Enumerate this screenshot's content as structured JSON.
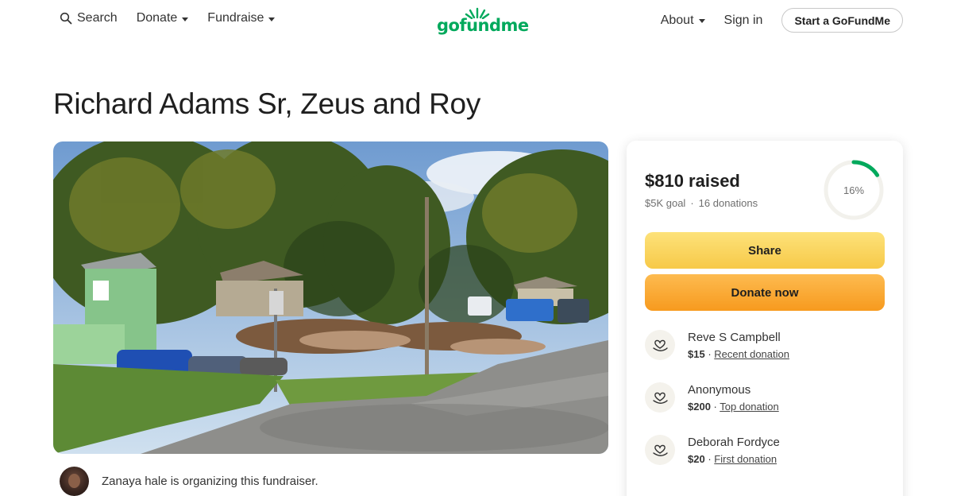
{
  "header": {
    "search_label": "Search",
    "donate_label": "Donate",
    "fundraise_label": "Fundraise",
    "logo_text": "gofundme",
    "about_label": "About",
    "signin_label": "Sign in",
    "start_label": "Start a GoFundMe"
  },
  "campaign": {
    "title": "Richard Adams Sr, Zeus and Roy",
    "organizer_text": "Zanaya hale is organizing this fundraiser."
  },
  "donation_card": {
    "raised": "$810 raised",
    "goal": "$5K goal",
    "separator": "·",
    "donation_count": "16 donations",
    "progress_label": "16%",
    "progress_fraction": 0.16,
    "share_label": "Share",
    "donate_label": "Donate now",
    "donors": [
      {
        "name": "Reve S Campbell",
        "amount": "$15",
        "tag": "Recent donation"
      },
      {
        "name": "Anonymous",
        "amount": "$200",
        "tag": "Top donation"
      },
      {
        "name": "Deborah Fordyce",
        "amount": "$20",
        "tag": "First donation"
      }
    ]
  },
  "colors": {
    "brand_green": "#02a95c",
    "share_yellow": "#f7c948",
    "donate_orange": "#f79a1e"
  }
}
